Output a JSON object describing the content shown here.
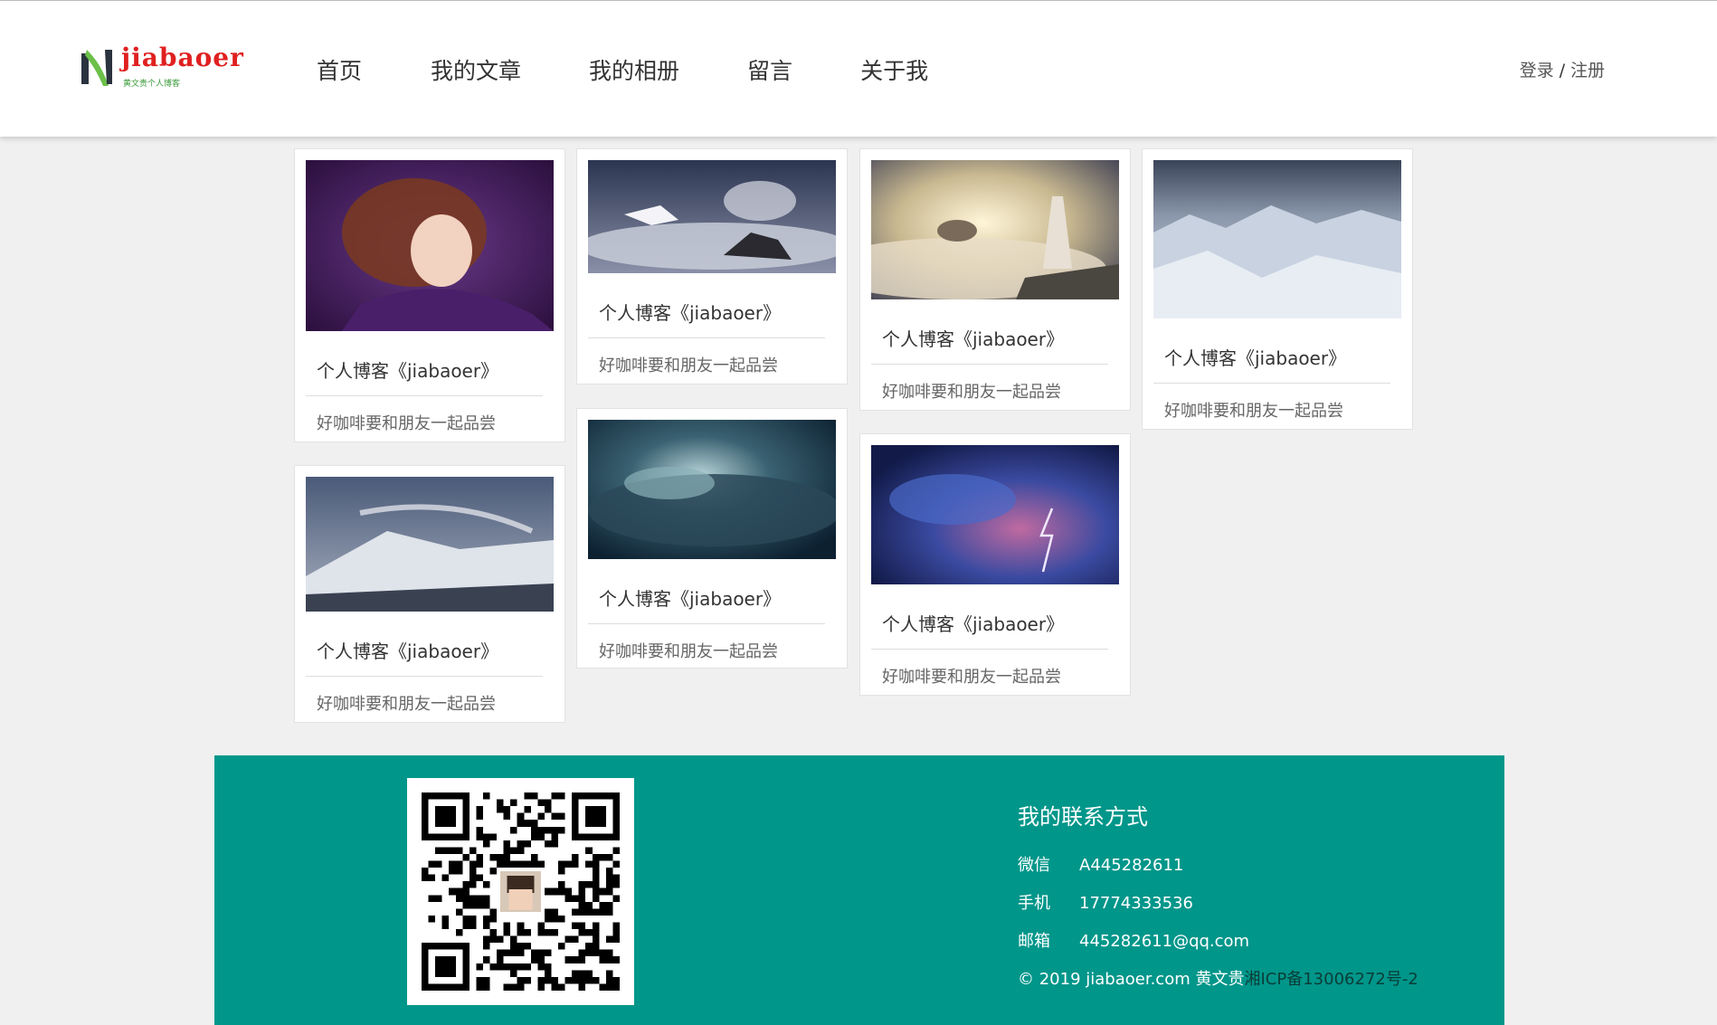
{
  "header": {
    "logo_text": "jiabaoer",
    "logo_slogan": "黄文贵个人博客",
    "nav": [
      "首页",
      "我的文章",
      "我的相册",
      "留言",
      "关于我"
    ],
    "login": "登录",
    "separator": "/",
    "register": "注册"
  },
  "cards": [
    {
      "title": "个人博客《jiabaoer》",
      "desc": "好咖啡要和朋友一起品尝",
      "image": "woman-purple-hair"
    },
    {
      "title": "个人博客《jiabaoer》",
      "desc": "好咖啡要和朋友一起品尝",
      "image": "pegasus-clouds"
    },
    {
      "title": "个人博客《jiabaoer》",
      "desc": "好咖啡要和朋友一起品尝",
      "image": "woman-cliff-clouds"
    },
    {
      "title": "个人博客《jiabaoer》",
      "desc": "好咖啡要和朋友一起品尝",
      "image": "snowy-mountains"
    },
    {
      "title": "个人博客《jiabaoer》",
      "desc": "好咖啡要和朋友一起品尝",
      "image": "mountain-fog"
    },
    {
      "title": "个人博客《jiabaoer》",
      "desc": "好咖啡要和朋友一起品尝",
      "image": "dark-clouds"
    },
    {
      "title": "个人博客《jiabaoer》",
      "desc": "好咖啡要和朋友一起品尝",
      "image": "lightning-storm"
    }
  ],
  "footer": {
    "contact_title": "我的联系方式",
    "wechat_label": "微信",
    "wechat_value": "A445282611",
    "phone_label": "手机",
    "phone_value": "17774333536",
    "email_label": "邮箱",
    "email_value": "445282611@qq.com",
    "copyright_prefix": "© 2019",
    "copyright_site": "jiabaoer.com",
    "copyright_name": "黄文贵",
    "copyright_icp": "湘ICP备13006272号-2"
  },
  "colors": {
    "footer_bg": "#00968a",
    "logo_red": "#e02020",
    "logo_green": "#3a9a3a"
  }
}
